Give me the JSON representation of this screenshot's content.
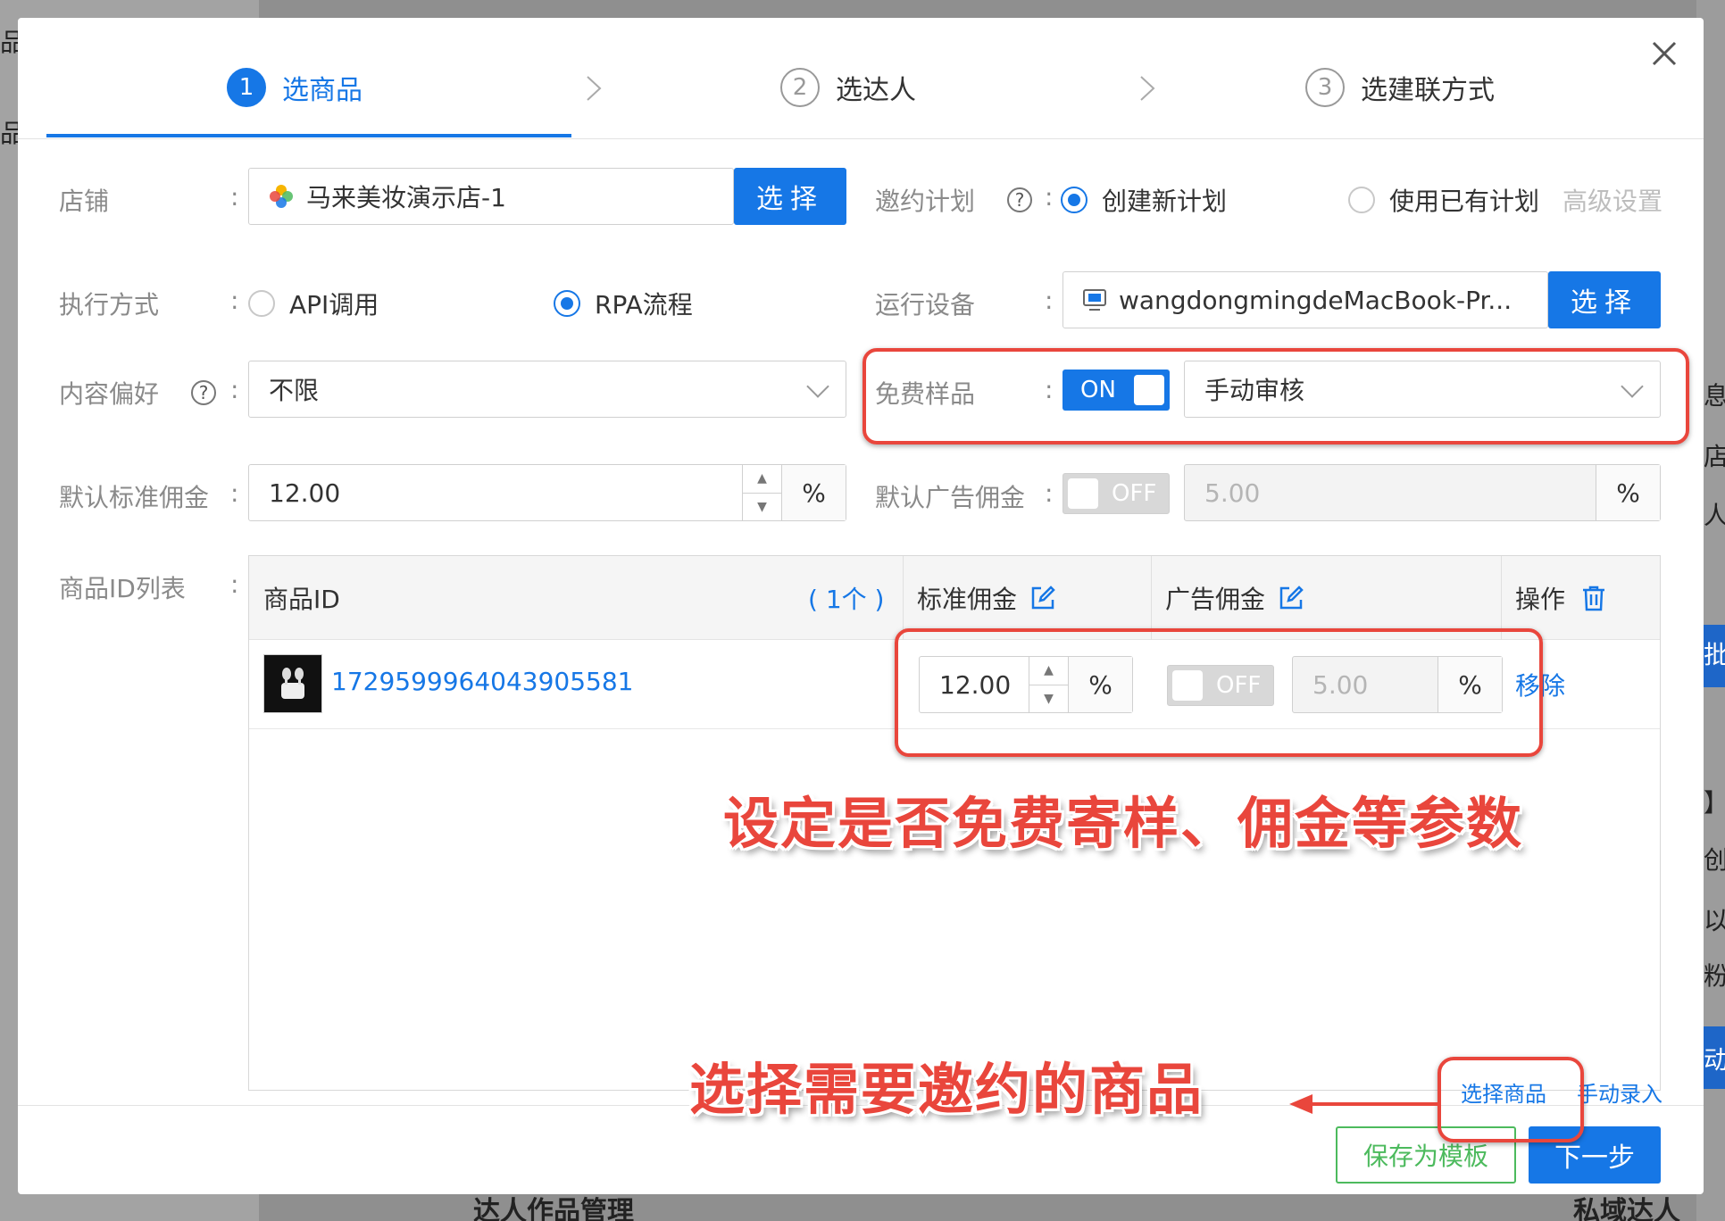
{
  "background": {
    "left_frag_1": "品",
    "left_frag_2": "品",
    "bottom_left": "达人作品管理",
    "bottom_right": "私域达人",
    "right_frag_1": "息",
    "right_frag_2": "店",
    "right_frag_3": "人",
    "right_frag_4": "批",
    "right_frag_5": "】",
    "right_frag_6": "创",
    "right_frag_7": "以",
    "right_frag_8": "粉",
    "right_frag_9": "动"
  },
  "steps": [
    {
      "num": "1",
      "label": "选商品",
      "active": true
    },
    {
      "num": "2",
      "label": "选达人",
      "active": false
    },
    {
      "num": "3",
      "label": "选建联方式",
      "active": false
    }
  ],
  "form": {
    "store_label": "店铺",
    "store_value": "马来美妆演示店-1",
    "store_button": "选择",
    "plan_label": "邀约计划",
    "plan_option_new": "创建新计划",
    "plan_option_existing": "使用已有计划",
    "advanced_settings": "高级设置",
    "exec_label": "执行方式",
    "exec_option_api": "API调用",
    "exec_option_rpa": "RPA流程",
    "device_label": "运行设备",
    "device_value": "wangdongmingdeMacBook-Pr...",
    "device_button": "选择",
    "content_pref_label": "内容偏好",
    "content_pref_value": "不限",
    "free_sample_label": "免费样品",
    "free_sample_toggle": "ON",
    "free_sample_review": "手动审核",
    "default_commission_label": "默认标准佣金",
    "default_commission_value": "12.00",
    "default_ad_commission_label": "默认广告佣金",
    "ad_toggle": "OFF",
    "ad_commission_value": "5.00",
    "percent": "%",
    "product_list_label": "商品ID列表",
    "colon": ":"
  },
  "table": {
    "col_product_id": "商品ID",
    "count": "( 1个 )",
    "col_standard": "标准佣金",
    "col_ad": "广告佣金",
    "col_action": "操作",
    "rows": [
      {
        "product_id": "1729599964043905581",
        "standard": "12.00",
        "ad_toggle": "OFF",
        "ad_value": "5.00",
        "action": "移除"
      }
    ]
  },
  "footer": {
    "select_products": "选择商品",
    "manual_entry": "手动录入",
    "save_template": "保存为模板",
    "next_step": "下一步"
  },
  "annotations": {
    "note_params": "设定是否免费寄样、佣金等参数",
    "note_select": "选择需要邀约的商品",
    "color": "#e9463c"
  },
  "colors": {
    "primary": "#1677e6",
    "success_outline": "#4cba5d"
  }
}
